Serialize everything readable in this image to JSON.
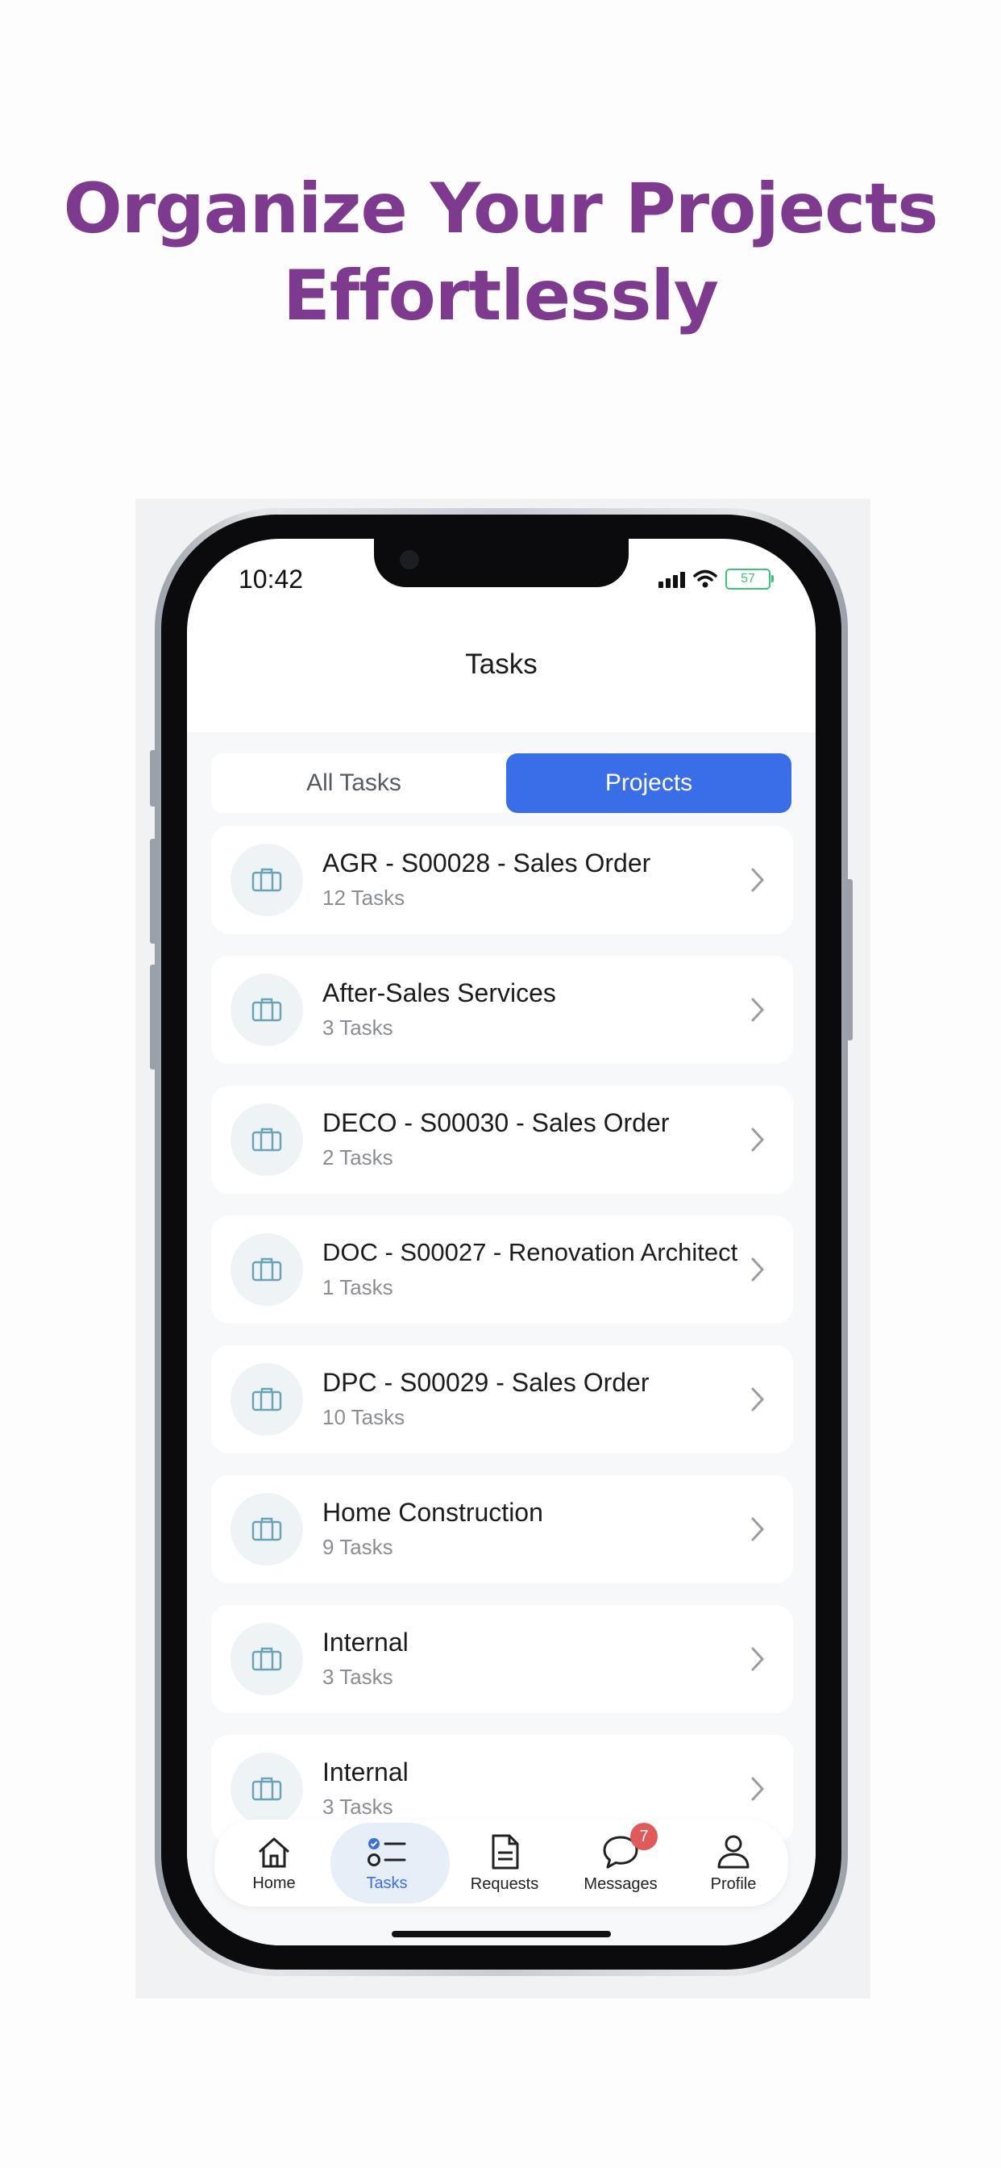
{
  "headline": {
    "line1": "Organize Your Projects",
    "line2": "Effortlessly"
  },
  "status_bar": {
    "time": "10:42",
    "battery": "57"
  },
  "header": {
    "title": "Tasks"
  },
  "segmented": {
    "options": [
      "All Tasks",
      "Projects"
    ],
    "selected": "Projects"
  },
  "projects": [
    {
      "title": "AGR - S00028 - Sales Order",
      "count": "12 Tasks",
      "icon": "briefcase-icon"
    },
    {
      "title": "After-Sales Services",
      "count": "3 Tasks",
      "icon": "briefcase-icon"
    },
    {
      "title": "DECO - S00030 - Sales Order",
      "count": "2 Tasks",
      "icon": "briefcase-icon"
    },
    {
      "title": "DOC - S00027 - Renovation Architect",
      "count": "1 Tasks",
      "icon": "briefcase-icon"
    },
    {
      "title": "DPC - S00029 - Sales Order",
      "count": "10 Tasks",
      "icon": "briefcase-icon"
    },
    {
      "title": "Home Construction",
      "count": "9 Tasks",
      "icon": "briefcase-icon"
    },
    {
      "title": "Internal",
      "count": "3 Tasks",
      "icon": "briefcase-icon"
    },
    {
      "title": "Internal",
      "count": "3 Tasks",
      "icon": "briefcase-icon"
    }
  ],
  "tabbar": {
    "items": [
      {
        "label": "Home",
        "icon": "home-icon"
      },
      {
        "label": "Tasks",
        "icon": "tasks-icon"
      },
      {
        "label": "Requests",
        "icon": "document-icon"
      },
      {
        "label": "Messages",
        "icon": "chat-icon",
        "badge": "7"
      },
      {
        "label": "Profile",
        "icon": "profile-icon"
      }
    ],
    "active": "Tasks"
  },
  "colors": {
    "headline": "#7e3a8f",
    "accent": "#3a6ee8",
    "badge": "#e05a5a",
    "icon_tint": "#6aa3b8"
  }
}
